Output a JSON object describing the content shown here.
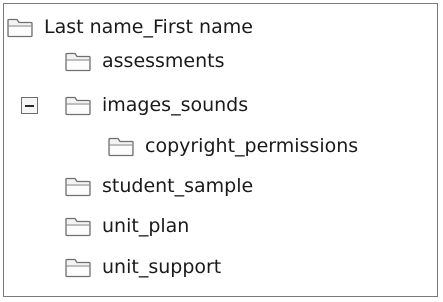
{
  "tree": {
    "root": {
      "label": "Last name_First name",
      "icon": "folder-icon"
    },
    "children": [
      {
        "label": "assessments",
        "icon": "folder-icon"
      },
      {
        "label": "images_sounds",
        "icon": "folder-icon",
        "expanded": true,
        "toggle_icon": "collapse-minus-icon",
        "children": [
          {
            "label": "copyright_permissions",
            "icon": "folder-icon"
          }
        ]
      },
      {
        "label": "student_sample",
        "icon": "folder-icon"
      },
      {
        "label": "unit_plan",
        "icon": "folder-icon"
      },
      {
        "label": "unit_support",
        "icon": "folder-icon"
      }
    ]
  }
}
